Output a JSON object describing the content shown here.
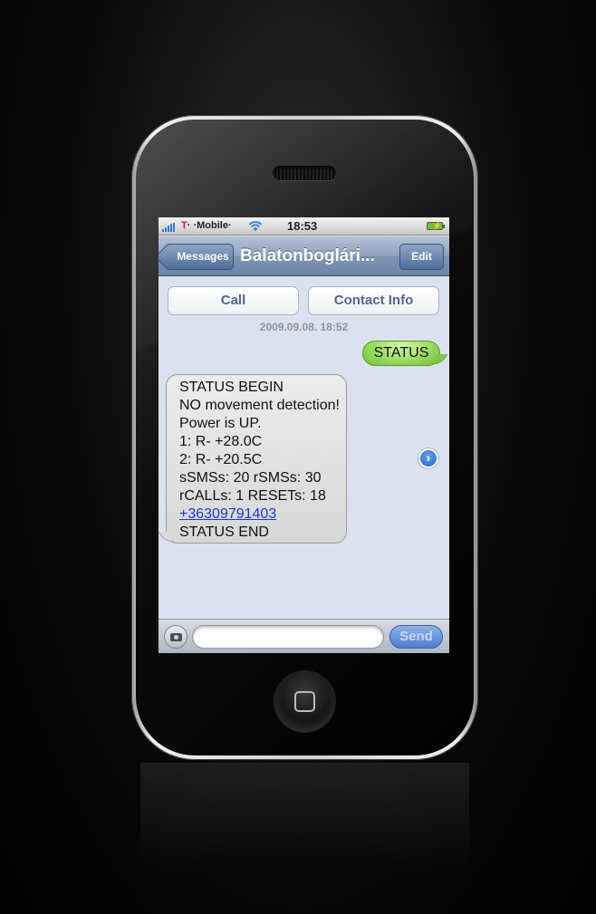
{
  "status_bar": {
    "carrier_prefix": "T",
    "carrier_name": "· ·Mobile·",
    "time": "18:53"
  },
  "navbar": {
    "back_label": "Messages",
    "title": "Balatonboglári...",
    "edit_label": "Edit"
  },
  "actions": {
    "call_label": "Call",
    "contact_info_label": "Contact Info"
  },
  "conversation": {
    "timestamp": "2009.09.08. 18:52",
    "sent_message": "STATUS",
    "received_lines": [
      "STATUS BEGIN",
      "NO movement detection!",
      "Power is UP.",
      "1: R- +28.0C",
      "2: R- +20.5C",
      "sSMSs: 20 rSMSs: 30",
      "rCALLs: 1 RESETs: 18"
    ],
    "received_link": "+36309791403",
    "received_last_line": "STATUS END"
  },
  "composer": {
    "input_value": "",
    "send_label": "Send"
  },
  "colors": {
    "sent_bubble": "#92d75a",
    "received_bubble": "#d8d8d8",
    "navbar": "#7e95b2",
    "link": "#1a37d8",
    "carrier_logo": "#e2007a"
  },
  "icons": {
    "signal": "signal-bars-icon",
    "wifi": "wifi-icon",
    "battery": "battery-charging-icon",
    "detail": "chevron-right-circle-icon",
    "camera": "camera-icon"
  }
}
